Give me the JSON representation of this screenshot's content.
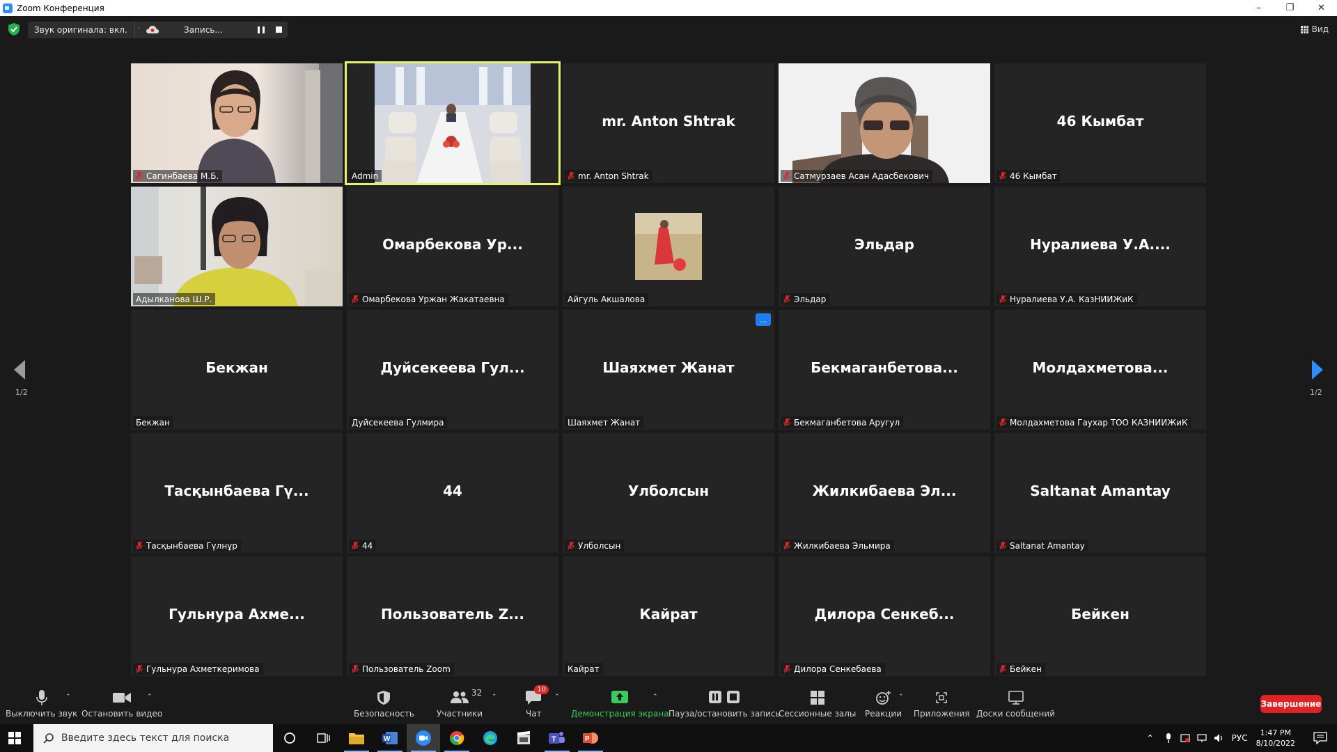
{
  "window": {
    "title": "Zoom Конференция"
  },
  "topbar": {
    "audio_label": "Звук оригинала: вкл.",
    "recording_label": "Запись...",
    "view_label": "Вид"
  },
  "colors": {
    "active_speaker": "#e6f36a",
    "end_button": "#dd2323",
    "share_green": "#3ccb5a",
    "mic_off_red": "#e02828"
  },
  "gallery": {
    "page_left": "1/2",
    "page_right": "1/2",
    "tiles": [
      {
        "big": "",
        "label": "Сагинбаева М.Б.",
        "muted": true,
        "video": "person-woman-glasses"
      },
      {
        "big": "",
        "label": "Admin",
        "muted": false,
        "video": "conference-room",
        "active": true
      },
      {
        "big": "mr. Anton Shtrak",
        "label": "mr. Anton Shtrak",
        "muted": true
      },
      {
        "big": "",
        "label": "Сатмурзаев Асан Адасбекович",
        "muted": true,
        "video": "person-man-sunglasses"
      },
      {
        "big": "46 Кымбат",
        "label": "46 Кымбат",
        "muted": true
      },
      {
        "big": "",
        "label": "Адылканова Ш.Р.",
        "muted": false,
        "video": "person-woman-yellow"
      },
      {
        "big": "Омарбекова Ур...",
        "label": "Омарбекова Уржан Жакатаевна",
        "muted": true
      },
      {
        "big": "",
        "label": "Айгуль Акшалова",
        "muted": false,
        "video": "avatar-red-dress"
      },
      {
        "big": "Эльдар",
        "label": "Эльдар",
        "muted": true
      },
      {
        "big": "Нуралиева У.А....",
        "label": "Нуралиева У.А. КазНИИЖиК",
        "muted": true
      },
      {
        "big": "Бекжан",
        "label": "Бекжан",
        "muted": false
      },
      {
        "big": "Дуйсекеева Гул...",
        "label": "Дуйсекеева Гулмира",
        "muted": false
      },
      {
        "big": "Шаяхмет Жанат",
        "label": "Шаяхмет Жанат",
        "muted": false,
        "more": "..."
      },
      {
        "big": "Бекмаганбетова...",
        "label": "Бекмаганбетова Аругул",
        "muted": true
      },
      {
        "big": "Молдахметова...",
        "label": "Молдахметова Гаухар ТОО КАЗНИИЖиК",
        "muted": true
      },
      {
        "big": "Тасқынбаева Гү...",
        "label": "Тасқынбаева Гүлнұр",
        "muted": true
      },
      {
        "big": "44",
        "label": "44",
        "muted": true
      },
      {
        "big": "Улболсын",
        "label": "Улболсын",
        "muted": true
      },
      {
        "big": "Жилкибаева Эл...",
        "label": "Жилкибаева Эльмира",
        "muted": true
      },
      {
        "big": "Saltanat Amantay",
        "label": "Saltanat Amantay",
        "muted": true
      },
      {
        "big": "Гульнура  Ахме...",
        "label": "Гульнура  Ахметкеримова",
        "muted": true
      },
      {
        "big": "Пользователь Z...",
        "label": "Пользователь Zoom",
        "muted": true
      },
      {
        "big": "Кайрат",
        "label": "Кайрат",
        "muted": false
      },
      {
        "big": "Дилора Сенкеб...",
        "label": "Дилора Сенкебаева",
        "muted": true
      },
      {
        "big": "Бейкен",
        "label": "Бейкен",
        "muted": true
      }
    ]
  },
  "toolbar": {
    "mute": "Выключить звук",
    "video": "Остановить видео",
    "security": "Безопасность",
    "participants": "Участники",
    "participants_count": "32",
    "chat": "Чат",
    "chat_badge": "10",
    "share": "Демонстрация экрана",
    "record": "Пауза/остановить запись",
    "breakout": "Сессионные залы",
    "reactions": "Реакции",
    "apps": "Приложения",
    "whiteboards": "Доски сообщений",
    "end": "Завершение"
  },
  "taskbar": {
    "search_placeholder": "Введите здесь текст для поиска",
    "lang": "РУС",
    "time": "1:47 PM",
    "date": "8/10/2022"
  }
}
